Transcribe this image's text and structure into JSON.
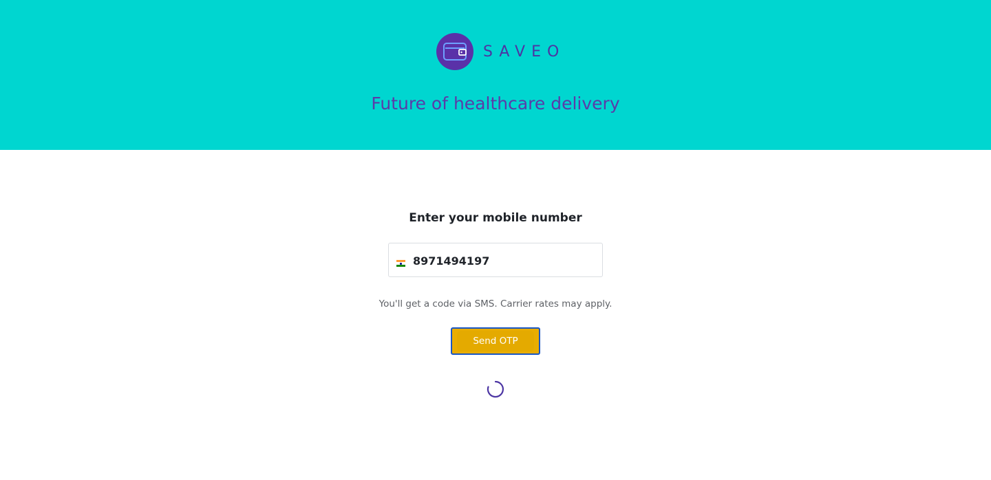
{
  "brand": {
    "name": "SAVEO",
    "icon": "wallet-icon",
    "badge_color": "#5a31a8",
    "accent_color": "#6ea0ff"
  },
  "hero": {
    "tagline": "Future of healthcare delivery",
    "background": "#00d6d0"
  },
  "login": {
    "title": "Enter your mobile number",
    "country_flag": "india-flag-icon",
    "phone_value": "8971494197",
    "helper_text": "You'll get a code via SMS. Carrier rates may apply.",
    "submit_label": "Send OTP",
    "button_color": "#e9ad00",
    "loading": "loading-spinner-icon"
  }
}
